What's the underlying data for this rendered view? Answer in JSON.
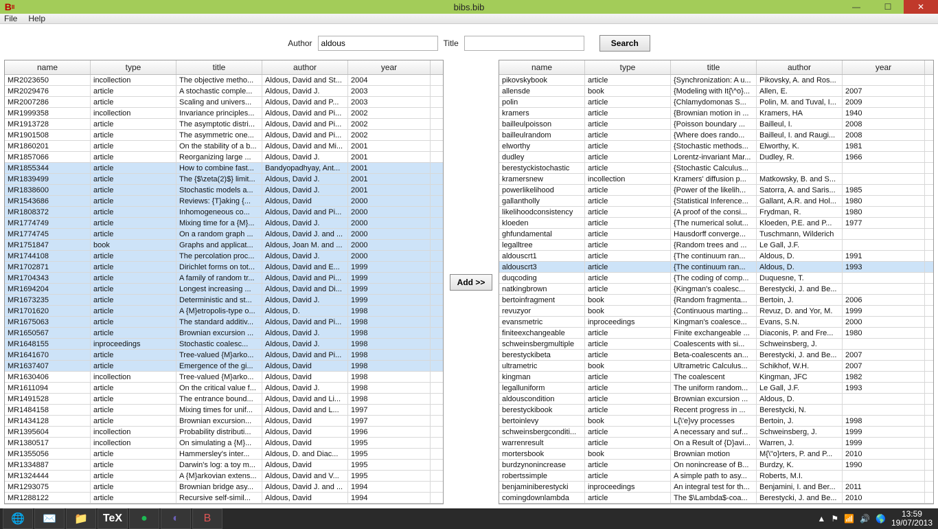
{
  "window": {
    "title": "bibs.bib"
  },
  "menu": {
    "file": "File",
    "help": "Help"
  },
  "search": {
    "author_label": "Author",
    "author_value": "aldous",
    "title_label": "Title",
    "title_value": "",
    "button": "Search"
  },
  "addbtn": "Add >>",
  "headers": {
    "name": "name",
    "type": "type",
    "title": "title",
    "author": "author",
    "year": "year"
  },
  "left": [
    {
      "sel": false,
      "name": "MR2023650",
      "type": "incollection",
      "title": "The objective metho...",
      "author": "Aldous, David and St...",
      "year": "2004"
    },
    {
      "sel": false,
      "name": "MR2029476",
      "type": "article",
      "title": "A stochastic comple...",
      "author": "Aldous, David J.",
      "year": "2003"
    },
    {
      "sel": false,
      "name": "MR2007286",
      "type": "article",
      "title": "Scaling and univers...",
      "author": "Aldous, David and P...",
      "year": "2003"
    },
    {
      "sel": false,
      "name": "MR1999358",
      "type": "incollection",
      "title": "Invariance principles...",
      "author": "Aldous, David and Pi...",
      "year": "2002"
    },
    {
      "sel": false,
      "name": "MR1913728",
      "type": "article",
      "title": "The asymptotic distri...",
      "author": "Aldous, David and Pi...",
      "year": "2002"
    },
    {
      "sel": false,
      "name": "MR1901508",
      "type": "article",
      "title": "The asymmetric one...",
      "author": "Aldous, David and Pi...",
      "year": "2002"
    },
    {
      "sel": false,
      "name": "MR1860201",
      "type": "article",
      "title": "On the stability of a b...",
      "author": "Aldous, David and Mi...",
      "year": "2001"
    },
    {
      "sel": false,
      "name": "MR1857066",
      "type": "article",
      "title": "Reorganizing large ...",
      "author": "Aldous, David J.",
      "year": "2001"
    },
    {
      "sel": true,
      "name": "MR1855344",
      "type": "article",
      "title": "How to combine fast...",
      "author": "Bandyopadhyay, Ant...",
      "year": "2001"
    },
    {
      "sel": true,
      "name": "MR1839499",
      "type": "article",
      "title": "The {$\\zeta(2)$} limit...",
      "author": "Aldous, David J.",
      "year": "2001"
    },
    {
      "sel": true,
      "name": "MR1838600",
      "type": "article",
      "title": "Stochastic models a...",
      "author": "Aldous, David J.",
      "year": "2001"
    },
    {
      "sel": true,
      "name": "MR1543686",
      "type": "article",
      "title": "Reviews: {T}aking {...",
      "author": "Aldous, David",
      "year": "2000"
    },
    {
      "sel": true,
      "name": "MR1808372",
      "type": "article",
      "title": "Inhomogeneous co...",
      "author": "Aldous, David and Pi...",
      "year": "2000"
    },
    {
      "sel": true,
      "name": "MR1774749",
      "type": "article",
      "title": "Mixing time for a {M}...",
      "author": "Aldous, David J.",
      "year": "2000"
    },
    {
      "sel": true,
      "name": "MR1774745",
      "type": "article",
      "title": "On a random graph ...",
      "author": "Aldous, David J. and ...",
      "year": "2000"
    },
    {
      "sel": true,
      "name": "MR1751847",
      "type": "book",
      "title": "Graphs and applicat...",
      "author": "Aldous, Joan M. and ...",
      "year": "2000"
    },
    {
      "sel": true,
      "name": "MR1744108",
      "type": "article",
      "title": "The percolation proc...",
      "author": "Aldous, David J.",
      "year": "2000"
    },
    {
      "sel": true,
      "name": "MR1702871",
      "type": "article",
      "title": "Dirichlet forms on tot...",
      "author": "Aldous, David and E...",
      "year": "1999"
    },
    {
      "sel": true,
      "name": "MR1704343",
      "type": "article",
      "title": "A family of random tr...",
      "author": "Aldous, David and Pi...",
      "year": "1999"
    },
    {
      "sel": true,
      "name": "MR1694204",
      "type": "article",
      "title": "Longest increasing ...",
      "author": "Aldous, David and Di...",
      "year": "1999"
    },
    {
      "sel": true,
      "name": "MR1673235",
      "type": "article",
      "title": "Deterministic and st...",
      "author": "Aldous, David J.",
      "year": "1999"
    },
    {
      "sel": true,
      "name": "MR1701620",
      "type": "article",
      "title": "A {M}etropolis-type o...",
      "author": "Aldous, D.",
      "year": "1998"
    },
    {
      "sel": true,
      "name": "MR1675063",
      "type": "article",
      "title": "The standard additiv...",
      "author": "Aldous, David and Pi...",
      "year": "1998"
    },
    {
      "sel": true,
      "name": "MR1650567",
      "type": "article",
      "title": "Brownian excursion ...",
      "author": "Aldous, David J.",
      "year": "1998"
    },
    {
      "sel": true,
      "name": "MR1648155",
      "type": "inproceedings",
      "title": "Stochastic coalesc...",
      "author": "Aldous, David J.",
      "year": "1998"
    },
    {
      "sel": true,
      "name": "MR1641670",
      "type": "article",
      "title": "Tree-valued {M}arko...",
      "author": "Aldous, David and Pi...",
      "year": "1998"
    },
    {
      "sel": true,
      "name": "MR1637407",
      "type": "article",
      "title": "Emergence of the gi...",
      "author": "Aldous, David",
      "year": "1998"
    },
    {
      "sel": false,
      "name": "MR1630406",
      "type": "incollection",
      "title": "Tree-valued {M}arko...",
      "author": "Aldous, David",
      "year": "1998"
    },
    {
      "sel": false,
      "name": "MR1611094",
      "type": "article",
      "title": "On the critical value f...",
      "author": "Aldous, David J.",
      "year": "1998"
    },
    {
      "sel": false,
      "name": "MR1491528",
      "type": "article",
      "title": "The entrance bound...",
      "author": "Aldous, David and Li...",
      "year": "1998"
    },
    {
      "sel": false,
      "name": "MR1484158",
      "type": "article",
      "title": "Mixing times for unif...",
      "author": "Aldous, David and L...",
      "year": "1997"
    },
    {
      "sel": false,
      "name": "MR1434128",
      "type": "article",
      "title": "Brownian excursion...",
      "author": "Aldous, David",
      "year": "1997"
    },
    {
      "sel": false,
      "name": "MR1395604",
      "type": "incollection",
      "title": "Probability distributi...",
      "author": "Aldous, David",
      "year": "1996"
    },
    {
      "sel": false,
      "name": "MR1380517",
      "type": "incollection",
      "title": "On simulating a {M}...",
      "author": "Aldous, David",
      "year": "1995"
    },
    {
      "sel": false,
      "name": "MR1355056",
      "type": "article",
      "title": "Hammersley's inter...",
      "author": "Aldous, D. and Diac...",
      "year": "1995"
    },
    {
      "sel": false,
      "name": "MR1334887",
      "type": "article",
      "title": "Darwin's log: a toy m...",
      "author": "Aldous, David",
      "year": "1995"
    },
    {
      "sel": false,
      "name": "MR1324444",
      "type": "article",
      "title": "A {M}arkovian extens...",
      "author": "Aldous, David and V...",
      "year": "1995"
    },
    {
      "sel": false,
      "name": "MR1293075",
      "type": "article",
      "title": "Brownian bridge asy...",
      "author": "Aldous, David J. and ...",
      "year": "1994"
    },
    {
      "sel": false,
      "name": "MR1288122",
      "type": "article",
      "title": "Recursive self-simil...",
      "author": "Aldous, David",
      "year": "1994"
    }
  ],
  "right": [
    {
      "sel": false,
      "name": "pikovskybook",
      "type": "article",
      "title": "{Synchronization: A u...",
      "author": "Pikovsky, A. and Ros...",
      "year": ""
    },
    {
      "sel": false,
      "name": "allensde",
      "type": "book",
      "title": "{Modeling with It{\\^o}...",
      "author": "Allen, E.",
      "year": "2007"
    },
    {
      "sel": false,
      "name": "polin",
      "type": "article",
      "title": "{Chlamydomonas S...",
      "author": "Polin, M. and Tuval, I...",
      "year": "2009"
    },
    {
      "sel": false,
      "name": "kramers",
      "type": "article",
      "title": "{Brownian motion in ...",
      "author": "Kramers, HA",
      "year": "1940"
    },
    {
      "sel": false,
      "name": "bailleulpoisson",
      "type": "article",
      "title": "{Poisson boundary ...",
      "author": "Bailleul, I.",
      "year": "2008"
    },
    {
      "sel": false,
      "name": "bailleulrandom",
      "type": "article",
      "title": "{Where does rando...",
      "author": "Bailleul, I. and Raugi...",
      "year": "2008"
    },
    {
      "sel": false,
      "name": "elworthy",
      "type": "article",
      "title": "{Stochastic methods...",
      "author": "Elworthy, K.",
      "year": "1981"
    },
    {
      "sel": false,
      "name": "dudley",
      "type": "article",
      "title": "Lorentz-invariant Mar...",
      "author": "Dudley, R.",
      "year": "1966"
    },
    {
      "sel": false,
      "name": "berestyckistochastic",
      "type": "article",
      "title": "{Stochastic Calculus...",
      "author": "",
      "year": ""
    },
    {
      "sel": false,
      "name": "kramersnew",
      "type": "incollection",
      "title": "Kramers' diffusion p...",
      "author": "Matkowsky, B. and S...",
      "year": ""
    },
    {
      "sel": false,
      "name": "powerlikelihood",
      "type": "article",
      "title": "{Power of the likelih...",
      "author": "Satorra, A. and Saris...",
      "year": "1985"
    },
    {
      "sel": false,
      "name": "gallantholly",
      "type": "article",
      "title": "{Statistical Inference...",
      "author": "Gallant, A.R. and Hol...",
      "year": "1980"
    },
    {
      "sel": false,
      "name": "likelihoodconsistency",
      "type": "article",
      "title": "{A proof of the consi...",
      "author": "Frydman, R.",
      "year": "1980"
    },
    {
      "sel": false,
      "name": "kloeden",
      "type": "article",
      "title": "{The numerical solut...",
      "author": "Kloeden, P.E. and P...",
      "year": "1977"
    },
    {
      "sel": false,
      "name": "ghfundamental",
      "type": "article",
      "title": "Hausdorff converge...",
      "author": "Tuschmann, Wilderich",
      "year": ""
    },
    {
      "sel": false,
      "name": "legalltree",
      "type": "article",
      "title": "{Random trees and ...",
      "author": "Le Gall, J.F.",
      "year": ""
    },
    {
      "sel": false,
      "name": "aldouscrt1",
      "type": "article",
      "title": "{The continuum ran...",
      "author": "Aldous, D.",
      "year": "1991"
    },
    {
      "sel": true,
      "name": "aldouscrt3",
      "type": "article",
      "title": "{The continuum ran...",
      "author": "Aldous, D.",
      "year": "1993"
    },
    {
      "sel": false,
      "name": "duqcoding",
      "type": "article",
      "title": "{The coding of comp...",
      "author": "Duquesne, T.",
      "year": ""
    },
    {
      "sel": false,
      "name": "natkingbrown",
      "type": "article",
      "title": "{Kingman's coalesc...",
      "author": "Berestycki, J. and Be...",
      "year": ""
    },
    {
      "sel": false,
      "name": "bertoinfragment",
      "type": "book",
      "title": "{Random fragmenta...",
      "author": "Bertoin, J.",
      "year": "2006"
    },
    {
      "sel": false,
      "name": "revuzyor",
      "type": "book",
      "title": "{Continuous marting...",
      "author": "Revuz, D. and Yor, M.",
      "year": "1999"
    },
    {
      "sel": false,
      "name": "evansmetric",
      "type": "inproceedings",
      "title": "Kingman's coalesce...",
      "author": "Evans, S.N.",
      "year": "2000"
    },
    {
      "sel": false,
      "name": "finiteexchangeable",
      "type": "article",
      "title": "Finite exchangeable ...",
      "author": "Diaconis, P. and Fre...",
      "year": "1980"
    },
    {
      "sel": false,
      "name": "schweinsbergmultiple",
      "type": "article",
      "title": "Coalescents with si...",
      "author": "Schweinsberg, J.",
      "year": ""
    },
    {
      "sel": false,
      "name": "berestyckibeta",
      "type": "article",
      "title": "Beta-coalescents an...",
      "author": "Berestycki, J. and Be...",
      "year": "2007"
    },
    {
      "sel": false,
      "name": "ultrametric",
      "type": "book",
      "title": "Ultrametric Calculus...",
      "author": "Schikhof, W.H.",
      "year": "2007"
    },
    {
      "sel": false,
      "name": "kingman",
      "type": "article",
      "title": "The coalescent",
      "author": "Kingman, JFC",
      "year": "1982"
    },
    {
      "sel": false,
      "name": "legalluniform",
      "type": "article",
      "title": "The uniform random...",
      "author": "Le Gall, J.F.",
      "year": "1993"
    },
    {
      "sel": false,
      "name": "aldouscondition",
      "type": "article",
      "title": "Brownian excursion ...",
      "author": "Aldous, D.",
      "year": ""
    },
    {
      "sel": false,
      "name": "berestyckibook",
      "type": "article",
      "title": "Recent progress in ...",
      "author": "Berestycki, N.",
      "year": ""
    },
    {
      "sel": false,
      "name": "bertoinlevy",
      "type": "book",
      "title": "L{\\'e}vy processes",
      "author": "Bertoin, J.",
      "year": "1998"
    },
    {
      "sel": false,
      "name": "schweinsbergconditi...",
      "type": "article",
      "title": "A necessary and suf...",
      "author": "Schweinsberg, J.",
      "year": "1999"
    },
    {
      "sel": false,
      "name": "warrenresult",
      "type": "article",
      "title": "On a Result of {D}avi...",
      "author": "Warren, J.",
      "year": "1999"
    },
    {
      "sel": false,
      "name": "mortersbook",
      "type": "book",
      "title": "Brownian motion",
      "author": "M{\\\"o}rters, P. and P...",
      "year": "2010"
    },
    {
      "sel": false,
      "name": "burdzynonincrease",
      "type": "article",
      "title": "On nonincrease of B...",
      "author": "Burdzy, K.",
      "year": "1990"
    },
    {
      "sel": false,
      "name": "robertssimple",
      "type": "article",
      "title": "A simple path to asy...",
      "author": "Roberts, M.I.",
      "year": ""
    },
    {
      "sel": false,
      "name": "benjaminiberestycki",
      "type": "inproceedings",
      "title": "An integral test for th...",
      "author": "Benjamini, I. and Ber...",
      "year": "2011"
    },
    {
      "sel": false,
      "name": "comingdownlambda",
      "type": "article",
      "title": "The $\\Lambda$-coa...",
      "author": "Berestycki, J. and Be...",
      "year": "2010"
    }
  ],
  "taskbar": {
    "time": "13:59",
    "date": "19/07/2013"
  }
}
